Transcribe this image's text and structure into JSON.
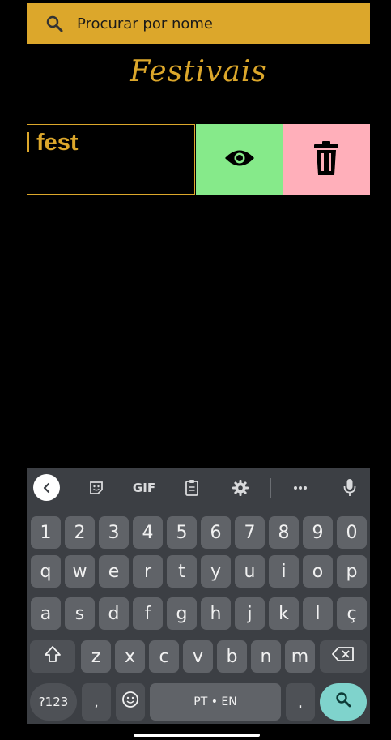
{
  "search": {
    "placeholder": "Procurar por nome"
  },
  "page": {
    "title": "Festivais"
  },
  "list": {
    "items": [
      {
        "title": "fest"
      }
    ]
  },
  "keyboard": {
    "toolbar": {
      "gif_label": "GIF"
    },
    "rows": [
      [
        "1",
        "2",
        "3",
        "4",
        "5",
        "6",
        "7",
        "8",
        "9",
        "0"
      ],
      [
        "q",
        "w",
        "e",
        "r",
        "t",
        "y",
        "u",
        "i",
        "o",
        "p"
      ],
      [
        "a",
        "s",
        "d",
        "f",
        "g",
        "h",
        "j",
        "k",
        "l",
        "ç"
      ],
      [
        "z",
        "x",
        "c",
        "v",
        "b",
        "n",
        "m"
      ]
    ],
    "symbols_label": "?123",
    "comma_label": ",",
    "space_label": "PT • EN",
    "period_label": "."
  },
  "colors": {
    "accent": "#dca72b",
    "view": "#86ea8a",
    "delete": "#ffafba",
    "keyboard": "#3c3f44",
    "key": "#606368",
    "search_key": "#7fd3cc"
  }
}
